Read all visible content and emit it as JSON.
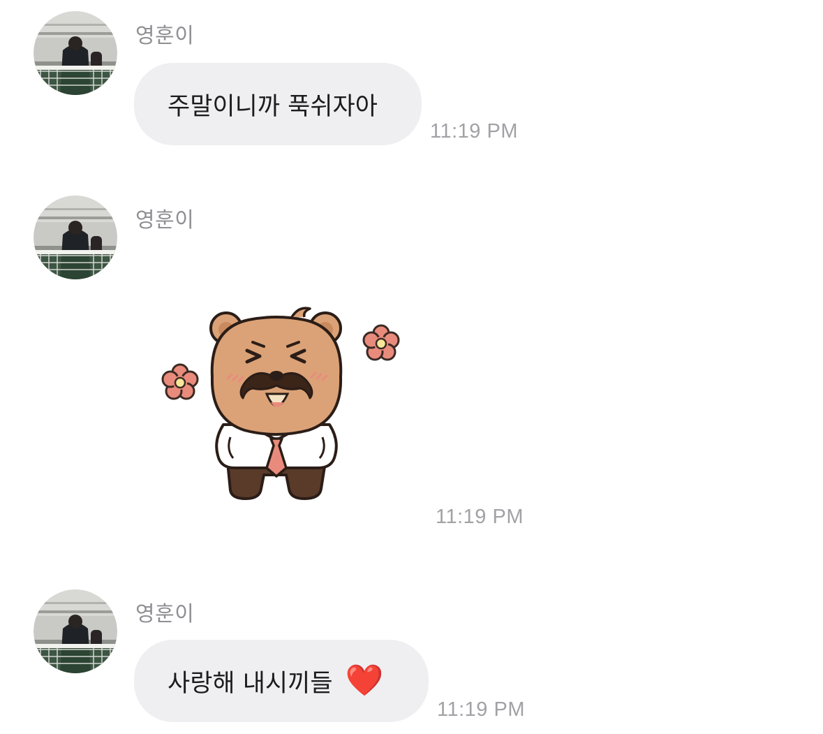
{
  "messages": [
    {
      "sender": "영훈이",
      "text": "주말이니까 푹쉬자아",
      "time": "11:19 PM"
    },
    {
      "sender": "영훈이",
      "sticker": "bear-with-mustache-sticker",
      "time": "11:19 PM"
    },
    {
      "sender": "영훈이",
      "text": "사랑해 내시끼들",
      "emoji": "❤️",
      "time": "11:19 PM"
    }
  ],
  "colors": {
    "bubble": "#efeff2",
    "sender_text": "#8e8e93",
    "timestamp": "#a1a1a6",
    "message_text": "#1c1c1e"
  }
}
